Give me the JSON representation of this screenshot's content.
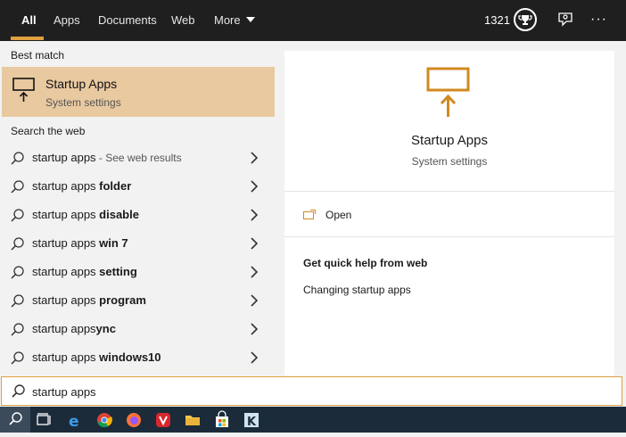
{
  "nav": {
    "tabs": [
      {
        "label": "All"
      },
      {
        "label": "Apps"
      },
      {
        "label": "Documents"
      },
      {
        "label": "Web"
      },
      {
        "label": "More"
      }
    ],
    "points": "1321",
    "more_dots": "···"
  },
  "left": {
    "best_match_title": "Best match",
    "best_match": {
      "title": "Startup Apps",
      "subtitle": "System settings"
    },
    "web_title": "Search the web",
    "results": [
      {
        "query": "startup apps",
        "bold": "",
        "suffix": " - See web results"
      },
      {
        "query": "startup apps ",
        "bold": "folder",
        "suffix": ""
      },
      {
        "query": "startup apps ",
        "bold": "disable",
        "suffix": ""
      },
      {
        "query": "startup apps ",
        "bold": "win 7",
        "suffix": ""
      },
      {
        "query": "startup apps ",
        "bold": "setting",
        "suffix": ""
      },
      {
        "query": "startup apps ",
        "bold": "program",
        "suffix": ""
      },
      {
        "query": "startup apps",
        "bold": "ync",
        "suffix": ""
      },
      {
        "query": "startup apps ",
        "bold": "windows10",
        "suffix": ""
      }
    ]
  },
  "right": {
    "title": "Startup Apps",
    "subtitle": "System settings",
    "open_label": "Open",
    "help_title": "Get quick help from web",
    "help_link": "Changing startup apps"
  },
  "search": {
    "value": "startup apps"
  },
  "colors": {
    "accent": "#e0a040",
    "highlight": "#e8c9a0",
    "nav_bg": "#1f1f1f",
    "taskbar_bg": "#1c2b3a"
  },
  "taskbar": {
    "icons": [
      "search-icon",
      "task-view-icon",
      "edge-icon",
      "chrome-icon",
      "firefox-icon",
      "vivaldi-icon",
      "file-explorer-icon",
      "store-icon",
      "app-k-icon"
    ]
  }
}
